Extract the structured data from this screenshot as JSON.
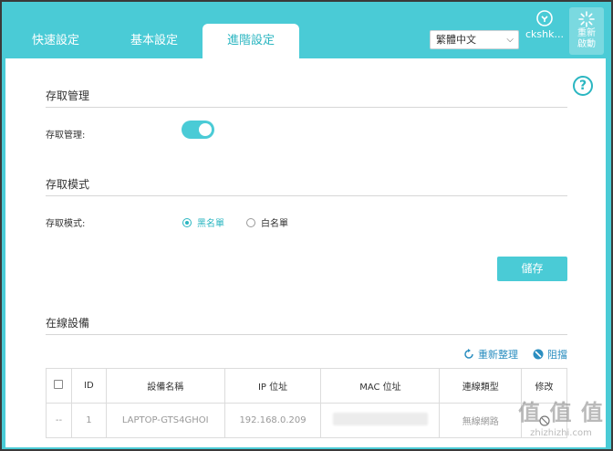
{
  "tabs": [
    {
      "label": "快速設定",
      "active": false
    },
    {
      "label": "基本設定",
      "active": false
    },
    {
      "label": "進階設定",
      "active": true
    }
  ],
  "language": {
    "selected": "繁體中文"
  },
  "account": {
    "label": "ckshk...",
    "icon": "account-icon"
  },
  "reboot": {
    "label": "重新啟動",
    "icon": "reboot-spinner-icon"
  },
  "help": {
    "icon": "help-icon",
    "glyph": "?"
  },
  "access_mgmt": {
    "section_title": "存取管理",
    "label": "存取管理:",
    "enabled": true
  },
  "access_mode": {
    "section_title": "存取模式",
    "label": "存取模式:",
    "options": [
      {
        "label": "黑名單",
        "selected": true
      },
      {
        "label": "白名單",
        "selected": false
      }
    ]
  },
  "save_label": "儲存",
  "online_devices": {
    "section_title": "在線設備",
    "actions": {
      "refresh": "重新整理",
      "block": "阻擋"
    },
    "columns": [
      "ID",
      "設備名稱",
      "IP 位址",
      "MAC 位址",
      "連線類型",
      "修改"
    ],
    "rows": [
      {
        "select": "--",
        "id": "1",
        "name": "LAPTOP-GTS4GHOI",
        "ip": "192.168.0.209",
        "mac": "",
        "type": "無線網路",
        "edit_icon": "edit-icon"
      }
    ]
  },
  "watermark": {
    "big": "值 值 值",
    "small": "zhizhizhi.com"
  },
  "colors": {
    "accent": "#4acbd6",
    "accent_text": "#2bb6c1",
    "link": "#2b8ec0"
  }
}
